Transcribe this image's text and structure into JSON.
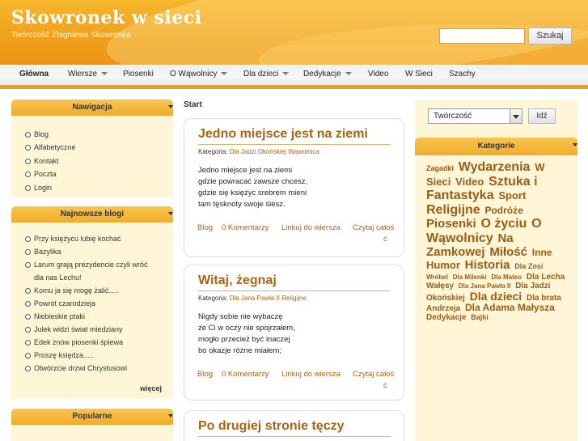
{
  "header": {
    "title": "Skowronek w sieci",
    "subtitle": "Twórczość Zbigniewa Skowronka",
    "search_button": "Szukaj",
    "search_value": ""
  },
  "nav": {
    "items": [
      {
        "label": "Główna",
        "active": true,
        "dropdown": false
      },
      {
        "label": "Wiersze",
        "active": false,
        "dropdown": true
      },
      {
        "label": "Piosenki",
        "active": false,
        "dropdown": false
      },
      {
        "label": "O Wąwolnicy",
        "active": false,
        "dropdown": true
      },
      {
        "label": "Dla dzieci",
        "active": false,
        "dropdown": true
      },
      {
        "label": "Dedykacje",
        "active": false,
        "dropdown": true
      },
      {
        "label": "Video",
        "active": false,
        "dropdown": false
      },
      {
        "label": "W Sieci",
        "active": false,
        "dropdown": false
      },
      {
        "label": "Szachy",
        "active": false,
        "dropdown": false
      }
    ]
  },
  "left": {
    "navigation": {
      "title": "Nawigacja",
      "items": [
        "Blog",
        "Alfabetyczne",
        "Kontakt",
        "Poczta",
        "Login"
      ]
    },
    "latest": {
      "title": "Najnowsze blogi",
      "items": [
        "Przy księżycu lubię kochać",
        "Bazylika",
        "Larum grają prezydencie czyli wróć",
        "dla nas Lechu!",
        "Komu ja się mogę żalić.....",
        "Powrót czarodzieja",
        "Niebieskie ptaki",
        "Julek widzi świat miedziany",
        "Edek znów piosenki śpiewa",
        "Proszę księdza.....",
        "Otwórzcie drzwi Chrystusowi"
      ],
      "more": "więcej"
    },
    "popular": {
      "title": "Popularne"
    }
  },
  "main": {
    "breadcrumb": "Start",
    "posts": [
      {
        "title": "Jedno miejsce jest na ziemi",
        "category_label": "Kategoria:",
        "categories": [
          "Dla Jadzi Okońskiej",
          "Wąwolnica"
        ],
        "lines": [
          "Jedno miejsce jest na ziemi",
          "gdzie powracać zawsze chcesz,",
          "gdzie się księżyc srebrem mieni",
          "tam tęsknoty swoje śiesz."
        ],
        "links": {
          "blog": "Blog",
          "comments": "0 Komentarzy",
          "link": "Linkuj do wiersza",
          "read1": "Czytaj całoś",
          "read2": "ć"
        }
      },
      {
        "title": "Witaj, żegnaj",
        "category_label": "Kategoria:",
        "categories": [
          "Dla Jana Pawła II",
          "Religijne"
        ],
        "lines": [
          "Nigdy sobie nie wybaczę",
          "że Ci w oczy nie spojrzałem,",
          "mogło przecież być inaczej",
          "bo okazje różne miałem;"
        ],
        "links": {
          "blog": "Blog",
          "comments": "0 Komentarzy",
          "link": "Linkuj do wiersza",
          "read1": "Czytaj całoś",
          "read2": "ć"
        }
      },
      {
        "title": "Po drugiej stronie tęczy"
      }
    ]
  },
  "right": {
    "select_value": "Twórczość",
    "go_button": "Idź",
    "categories_title": "Kategorie",
    "tags": [
      {
        "label": "Zagadki",
        "size": 9
      },
      {
        "label": "Wydarzenia",
        "size": 16
      },
      {
        "label": "W Sieci",
        "size": 13
      },
      {
        "label": "Video",
        "size": 13
      },
      {
        "label": "Sztuka i Fantastyka",
        "size": 16
      },
      {
        "label": "Sport",
        "size": 13
      },
      {
        "label": "Religijne",
        "size": 16
      },
      {
        "label": "Podróże",
        "size": 12
      },
      {
        "label": "Piosenki",
        "size": 15
      },
      {
        "label": "O życiu",
        "size": 16
      },
      {
        "label": "O Wąwolnicy",
        "size": 16
      },
      {
        "label": "Na Zamkowej",
        "size": 15
      },
      {
        "label": "Miłość",
        "size": 15
      },
      {
        "label": "Inne",
        "size": 12
      },
      {
        "label": "Humor",
        "size": 13
      },
      {
        "label": "Historia",
        "size": 15
      },
      {
        "label": "Dla Zosi",
        "size": 9
      },
      {
        "label": "Wróbel",
        "size": 8
      },
      {
        "label": "Dla Milenki",
        "size": 8
      },
      {
        "label": "Dla Mateo",
        "size": 8
      },
      {
        "label": "Dla Lecha Wałęsy",
        "size": 10
      },
      {
        "label": "Dla Jana Pawła II",
        "size": 8
      },
      {
        "label": "Dla Jadzi Okońskiej",
        "size": 10
      },
      {
        "label": "Dla dzieci",
        "size": 14
      },
      {
        "label": "Dla brata Andrzeja",
        "size": 10
      },
      {
        "label": "Dla Adama Małysza",
        "size": 12
      },
      {
        "label": "Dedykacje",
        "size": 10
      },
      {
        "label": "Bajki",
        "size": 9
      }
    ]
  }
}
